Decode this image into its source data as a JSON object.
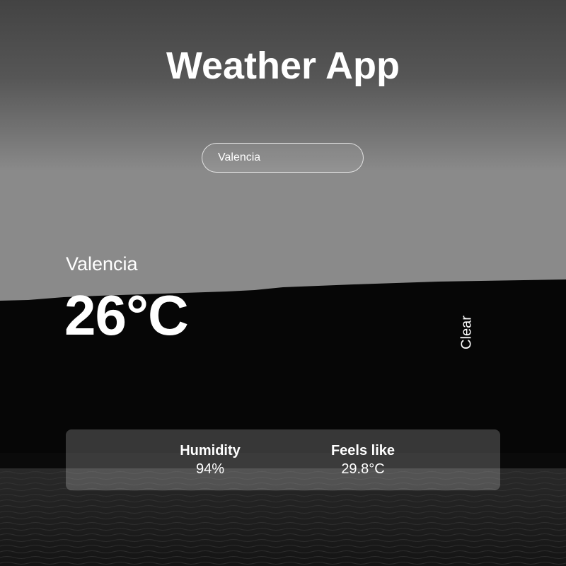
{
  "app": {
    "title": "Weather App"
  },
  "search": {
    "value": "Valencia"
  },
  "weather": {
    "city": "Valencia",
    "temperature": "26°C",
    "condition": "Clear"
  },
  "details": {
    "humidity_label": "Humidity",
    "humidity_value": "94%",
    "feels_like_label": "Feels like",
    "feels_like_value": "29.8°C"
  },
  "colors": {
    "text": "#ffffff",
    "sky_top": "#454545",
    "sky_horizon": "#8a8a8a",
    "hills": "#050505",
    "water": "#1c1c1c"
  },
  "background": {
    "image": "grayscale-lake-sunset-photo"
  }
}
